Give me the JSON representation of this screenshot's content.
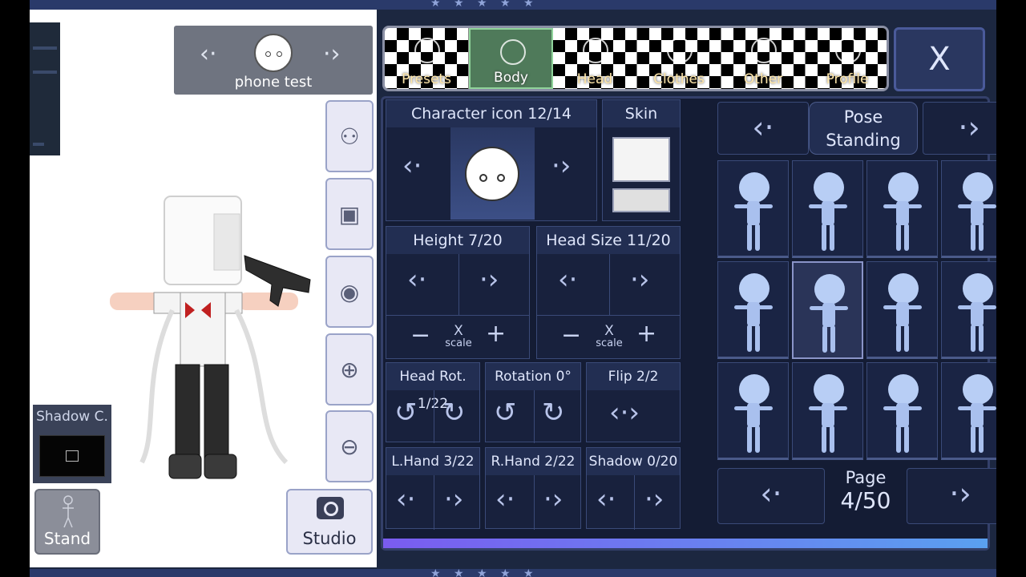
{
  "character": {
    "name": "phone test"
  },
  "side_buttons": [
    {
      "name": "add-character-button",
      "glyph": "⚇"
    },
    {
      "name": "background-button",
      "glyph": "▣"
    },
    {
      "name": "hide-ui-button",
      "glyph": "◉"
    },
    {
      "name": "zoom-in-button",
      "glyph": "⊕"
    },
    {
      "name": "zoom-out-button",
      "glyph": "⊖"
    }
  ],
  "shadow_panel": {
    "label": "Shadow C."
  },
  "stand_button": {
    "label": "Stand"
  },
  "studio_button": {
    "label": "Studio"
  },
  "tabs": [
    {
      "label": "Presets",
      "active": false
    },
    {
      "label": "Body",
      "active": true
    },
    {
      "label": "Head",
      "active": false
    },
    {
      "label": "Clothes",
      "active": false
    },
    {
      "label": "Other",
      "active": false
    },
    {
      "label": "Profile",
      "active": false
    }
  ],
  "close_button": {
    "label": "X"
  },
  "body_controls": {
    "character_icon": "Character icon 12/14",
    "skin": "Skin",
    "height": "Height 7/20",
    "head_size": "Head Size 11/20",
    "x_label": "X",
    "scale_label": "scale",
    "head_rot": "Head Rot. 1/22",
    "rotation": "Rotation 0°",
    "flip": "Flip 2/2",
    "l_hand": "L.Hand 3/22",
    "r_hand": "R.Hand 2/22",
    "shadow": "Shadow 0/20"
  },
  "pose": {
    "title_line1": "Pose",
    "title_line2": "Standing",
    "selected_index": 5,
    "count": 12
  },
  "page": {
    "label": "Page",
    "value": "4/50"
  },
  "colors": {
    "panel_bg": "#141c34",
    "accent": "#7a5cf0",
    "active_tab": "#4f7a5a"
  }
}
